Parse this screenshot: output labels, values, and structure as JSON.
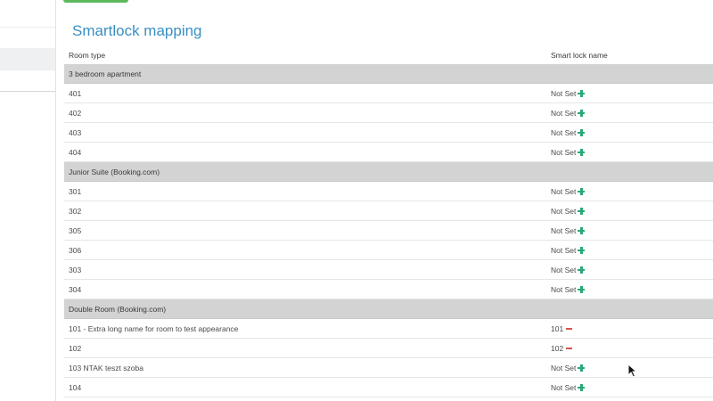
{
  "page": {
    "title": "Smartlock mapping"
  },
  "table": {
    "headers": {
      "room_type": "Room type",
      "smart_lock_name": "Smart lock name"
    },
    "rows": [
      {
        "kind": "group",
        "name": "3 bedroom apartment"
      },
      {
        "kind": "room",
        "name": "401",
        "lock": "Not Set",
        "action": "add"
      },
      {
        "kind": "room",
        "name": "402",
        "lock": "Not Set",
        "action": "add"
      },
      {
        "kind": "room",
        "name": "403",
        "lock": "Not Set",
        "action": "add"
      },
      {
        "kind": "room",
        "name": "404",
        "lock": "Not Set",
        "action": "add"
      },
      {
        "kind": "group",
        "name": "Junior Suite (Booking.com)"
      },
      {
        "kind": "room",
        "name": "301",
        "lock": "Not Set",
        "action": "add"
      },
      {
        "kind": "room",
        "name": "302",
        "lock": "Not Set",
        "action": "add"
      },
      {
        "kind": "room",
        "name": "305",
        "lock": "Not Set",
        "action": "add"
      },
      {
        "kind": "room",
        "name": "306",
        "lock": "Not Set",
        "action": "add"
      },
      {
        "kind": "room",
        "name": "303",
        "lock": "Not Set",
        "action": "add"
      },
      {
        "kind": "room",
        "name": "304",
        "lock": "Not Set",
        "action": "add"
      },
      {
        "kind": "group",
        "name": "Double Room (Booking.com)"
      },
      {
        "kind": "room",
        "name": "101 - Extra long name for room to test appearance",
        "lock": "101",
        "action": "remove"
      },
      {
        "kind": "room",
        "name": "102",
        "lock": "102",
        "action": "remove"
      },
      {
        "kind": "room",
        "name": "103 NTAK teszt szoba",
        "lock": "Not Set",
        "action": "add"
      },
      {
        "kind": "room",
        "name": "104",
        "lock": "Not Set",
        "action": "add"
      }
    ]
  },
  "icons": {
    "add": "plus-icon",
    "remove": "minus-icon",
    "cursor": "mouse-pointer-icon"
  },
  "colors": {
    "title": "#3a8fc2",
    "group_row_bg": "#d3d3d3",
    "add_icon": "#2aa876",
    "remove_icon": "#d9534f",
    "top_button": "#5cb85c"
  }
}
